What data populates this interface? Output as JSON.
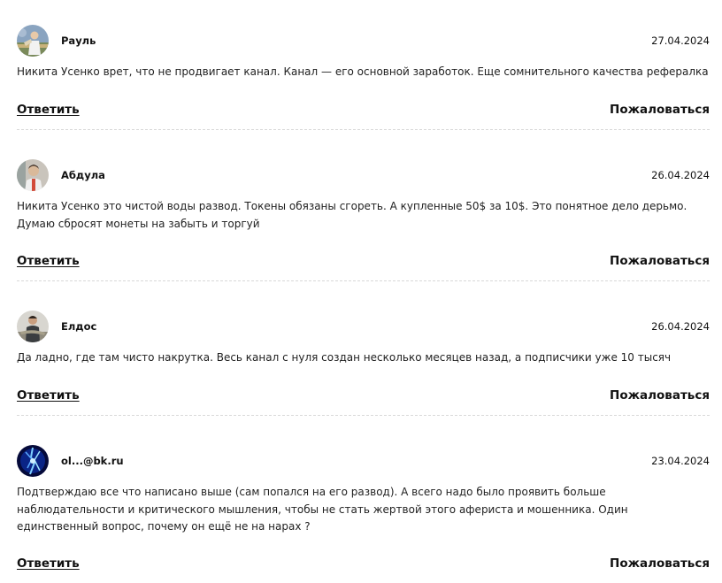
{
  "comments": [
    {
      "author": "Рауль",
      "date": "27.04.2024",
      "text": "Никита Усенко врет, что не продвигает канал. Канал — его основной заработок. Еще сомнительного качества рефералка",
      "reply_label": "Ответить",
      "report_label": "Пожаловаться",
      "avatar_icon": "user-photo-avatar-icon"
    },
    {
      "author": "Абдула",
      "date": "26.04.2024",
      "text": "Никита Усенко это чистой воды развод. Токены обязаны сгореть. А купленные 50$ за 10$. Это понятное дело дерьмо. Думаю сбросят монеты на забыть и торгуй",
      "reply_label": "Ответить",
      "report_label": "Пожаловаться",
      "avatar_icon": "user-photo-avatar-icon"
    },
    {
      "author": "Елдос",
      "date": "26.04.2024",
      "text": "Да ладно, где там чисто накрутка. Весь канал с нуля создан несколько месяцев назад, а подписчики уже 10 тысяч",
      "reply_label": "Ответить",
      "report_label": "Пожаловаться",
      "avatar_icon": "user-photo-avatar-icon"
    },
    {
      "author": "ol...@bk.ru",
      "date": "23.04.2024",
      "text": "Подтверждаю все что написано выше (сам попался на его развод). А всего надо было проявить больше наблюдательности и критического мышления, чтобы не стать жертвой этого афериста и мошенника. Один единственный вопрос, почему он ещё не на нарах ?",
      "reply_label": "Ответить",
      "report_label": "Пожаловаться",
      "avatar_icon": "blue-abstract-avatar-icon"
    }
  ]
}
